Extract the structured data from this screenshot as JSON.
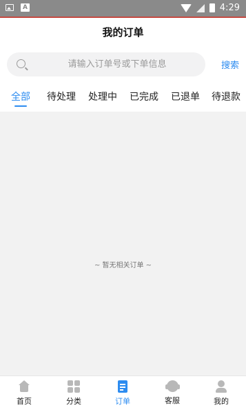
{
  "status_bar": {
    "time": "4:29"
  },
  "header": {
    "title": "我的订单"
  },
  "search": {
    "placeholder": "请输入订单号或下单信息",
    "button_label": "搜索"
  },
  "tabs": [
    {
      "label": "全部",
      "active": true
    },
    {
      "label": "待处理"
    },
    {
      "label": "处理中"
    },
    {
      "label": "已完成"
    },
    {
      "label": "已退单"
    },
    {
      "label": "待退款"
    }
  ],
  "empty_message": "~ 暂无相关订单 ~",
  "bottom_nav": [
    {
      "label": "首页",
      "icon": "home-icon"
    },
    {
      "label": "分类",
      "icon": "category-icon"
    },
    {
      "label": "订单",
      "icon": "order-icon",
      "active": true
    },
    {
      "label": "客服",
      "icon": "customer-service-icon"
    },
    {
      "label": "我的",
      "icon": "profile-icon"
    }
  ],
  "colors": {
    "accent": "#2d8cf0",
    "status_bar": "#8a8a8a",
    "background": "#f2f2f2"
  }
}
